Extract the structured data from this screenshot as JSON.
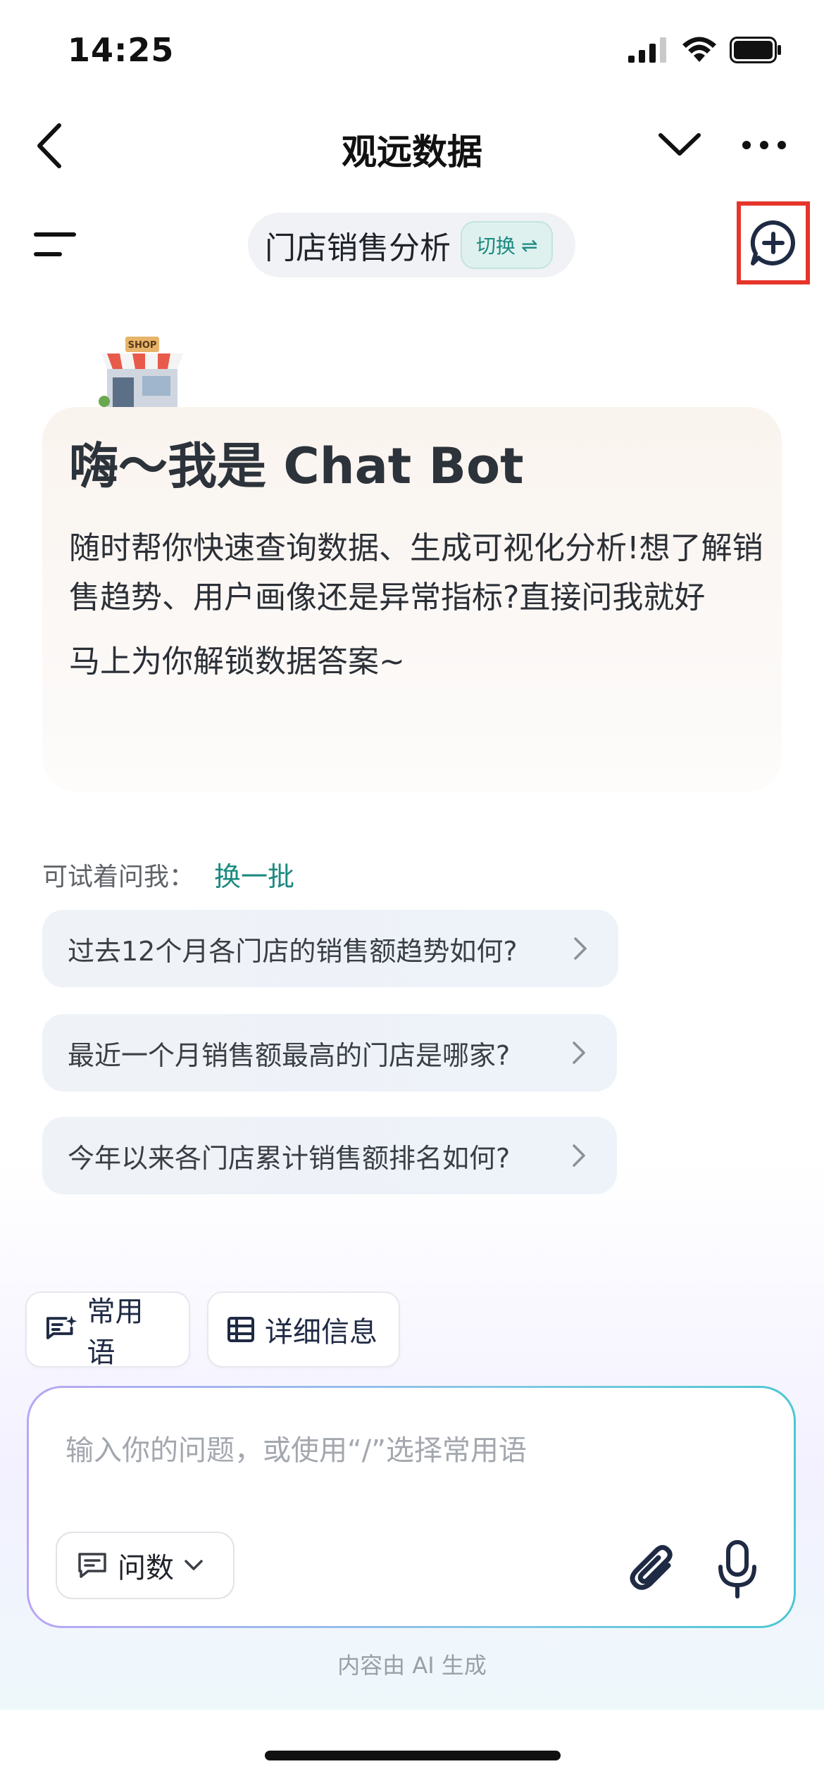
{
  "status_bar": {
    "time": "14:25"
  },
  "nav": {
    "title": "观远数据"
  },
  "agent": {
    "name": "门店销售分析",
    "switch_label": "切换",
    "switch_icon": "⇌"
  },
  "welcome": {
    "title": "嗨～我是 Chat Bot",
    "description": "随时帮你快速查询数据、生成可视化分析!想了解销售趋势、用户画像还是异常指标?直接问我就好",
    "cta": "马上为你解锁数据答案~",
    "illustration_sign": "SHOP"
  },
  "suggestions": {
    "label": "可试着问我：",
    "refresh": "换一批",
    "items": [
      "过去12个月各门店的销售额趋势如何?",
      "最近一个月销售额最高的门店是哪家?",
      "今年以来各门店累计销售额排名如何?"
    ]
  },
  "quick_chips": [
    {
      "label": "常用语",
      "icon": "phrases-icon"
    },
    {
      "label": "详细信息",
      "icon": "table-icon"
    }
  ],
  "input": {
    "placeholder": "输入你的问题，或使用“/”选择常用语",
    "mode": "问数"
  },
  "footer": {
    "note": "内容由 AI 生成"
  },
  "colors": {
    "accent": "#1a8a80",
    "highlight_box": "#e5352b",
    "icon_dark": "#1f2a44"
  }
}
